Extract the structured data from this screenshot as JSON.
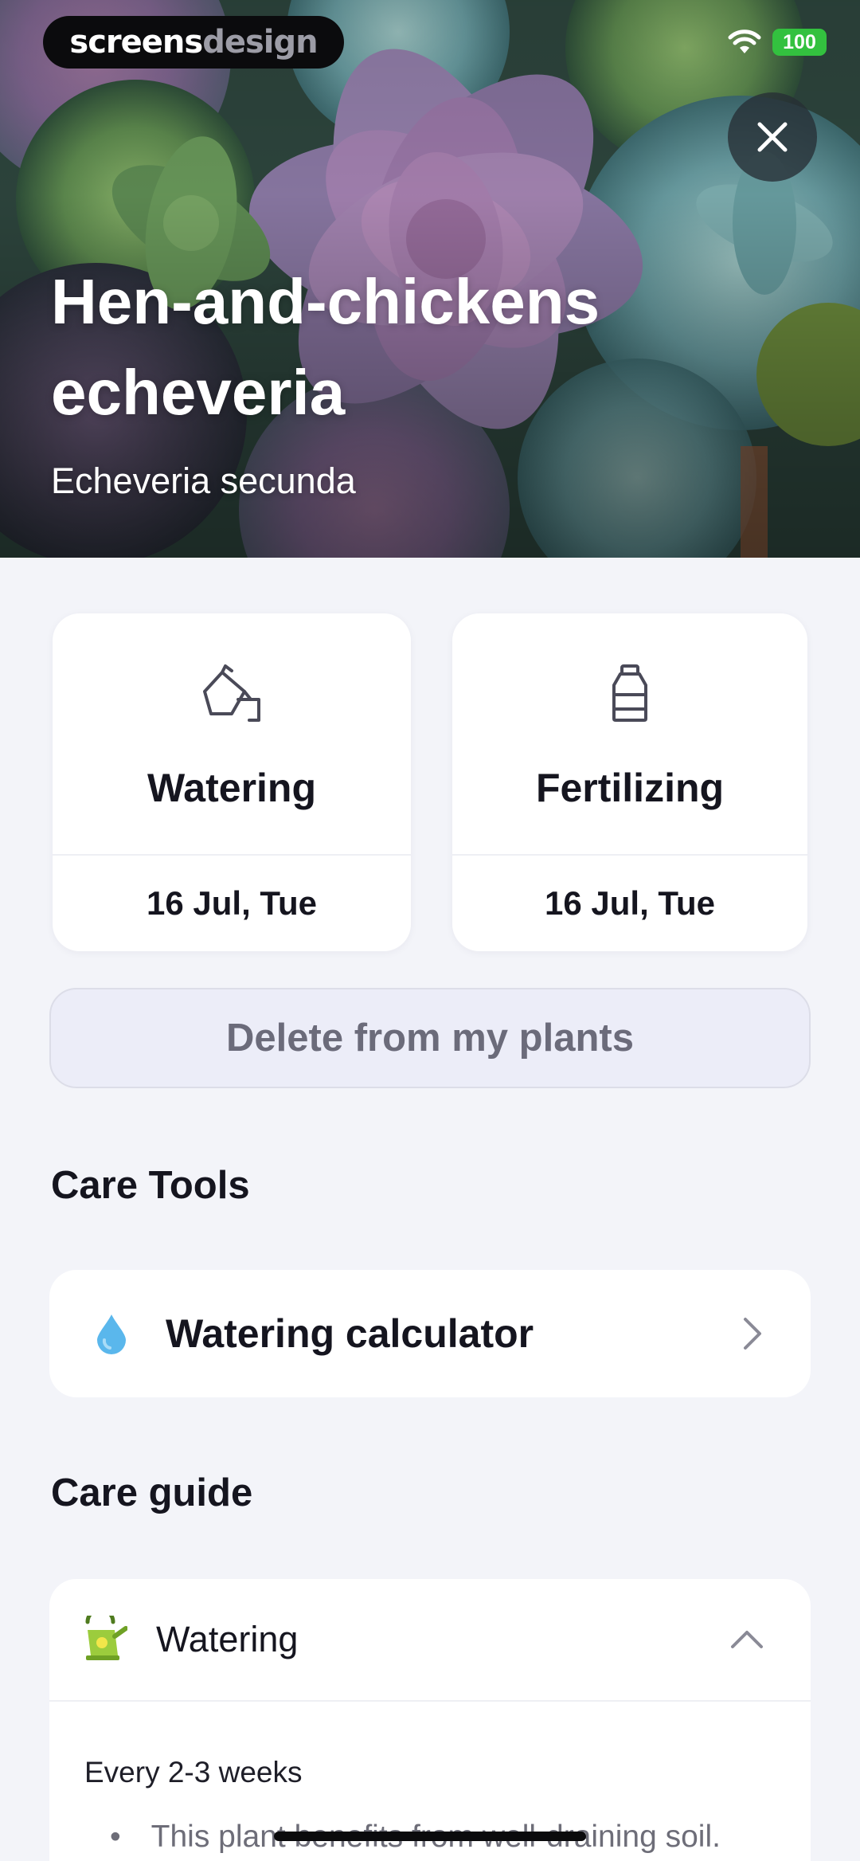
{
  "status_bar": {
    "brand_part1": "screens",
    "brand_part2": "design",
    "battery": "100"
  },
  "plant": {
    "name": "Hen-and-chickens echeveria",
    "latin_name": "Echeveria secunda"
  },
  "schedule": [
    {
      "title": "Watering",
      "date": "16 Jul, Tue",
      "icon": "watering-can-icon"
    },
    {
      "title": "Fertilizing",
      "date": "16 Jul, Tue",
      "icon": "fertilizer-bottle-icon"
    }
  ],
  "delete_button": "Delete from my plants",
  "care_tools": {
    "title": "Care Tools",
    "items": [
      {
        "label": "Watering calculator",
        "icon": "water-drop-icon"
      }
    ]
  },
  "care_guide": {
    "title": "Care guide",
    "sections": [
      {
        "label": "Watering",
        "icon": "watering-can-icon",
        "frequency": "Every 2-3 weeks",
        "bullets": [
          "This plant benefits from well-draining soil."
        ]
      }
    ]
  },
  "colors": {
    "background": "#f3f4f9",
    "card": "#ffffff",
    "delete_bg": "#ecedf8",
    "drop_blue": "#5ab7ec",
    "guide_icon_green": "#8cc63f",
    "battery_green": "#33c13f"
  }
}
